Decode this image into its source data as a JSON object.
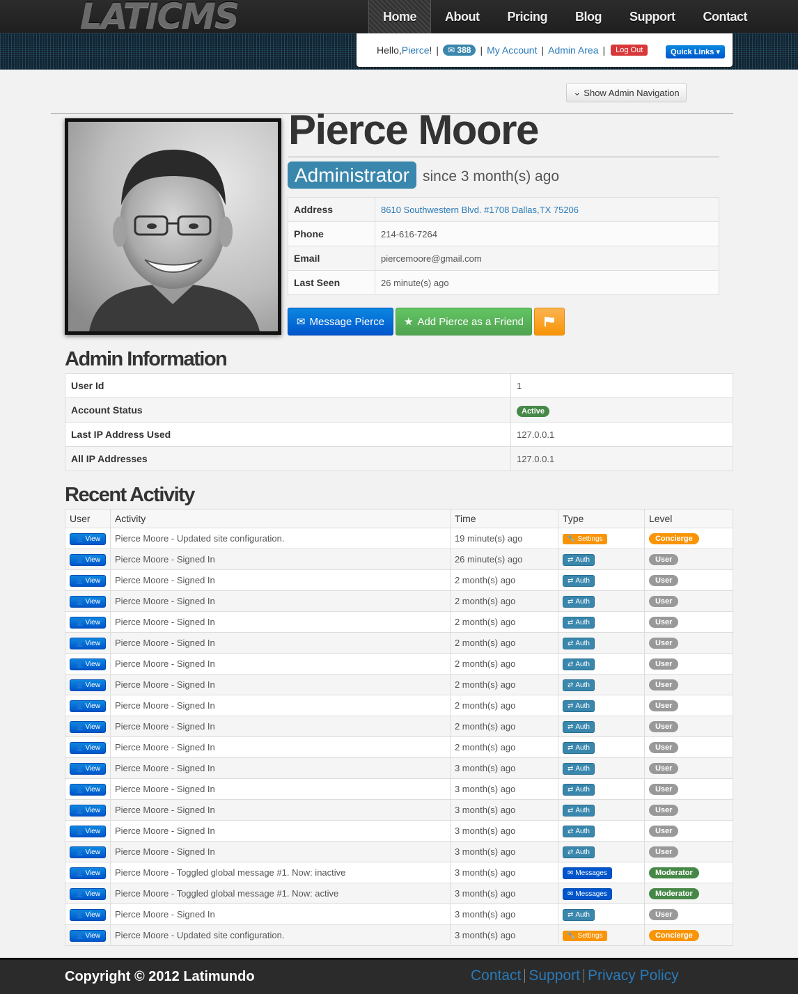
{
  "brand": {
    "logo": "LATICMS"
  },
  "nav": [
    {
      "label": "Home",
      "active": true
    },
    {
      "label": "About"
    },
    {
      "label": "Pricing"
    },
    {
      "label": "Blog"
    },
    {
      "label": "Support"
    },
    {
      "label": "Contact"
    }
  ],
  "userbar": {
    "hello": "Hello, ",
    "username": "Pierce",
    "exclaim": "!",
    "message_count": "388",
    "my_account": "My Account",
    "admin_area": "Admin Area",
    "logout": "Log Out",
    "quick_links": "Quick Links"
  },
  "admin_nav_button": "Show Admin Navigation",
  "profile": {
    "name": "Pierce Moore",
    "role": "Administrator",
    "since": "since 3 month(s) ago",
    "fields": [
      {
        "key": "Address",
        "value": "8610 Southwestern Blvd. #1708 Dallas,TX 75206",
        "link": true
      },
      {
        "key": "Phone",
        "value": "214-616-7264"
      },
      {
        "key": "Email",
        "value": "piercemoore@gmail.com"
      },
      {
        "key": "Last Seen",
        "value": "26 minute(s) ago"
      }
    ],
    "message_button": "Message Pierce",
    "friend_button": "Add Pierce as a Friend"
  },
  "admin_info": {
    "title": "Admin Information",
    "rows": [
      {
        "key": "User Id",
        "value": "1"
      },
      {
        "key": "Account Status",
        "value": "Active",
        "badge": true
      },
      {
        "key": "Last IP Address Used",
        "value": "127.0.0.1"
      },
      {
        "key": "All IP Addresses",
        "value": "127.0.0.1"
      }
    ]
  },
  "recent_activity": {
    "title": "Recent Activity",
    "columns": [
      "User",
      "Activity",
      "Time",
      "Type",
      "Level"
    ],
    "view_label": "View",
    "rows": [
      {
        "activity": "Pierce Moore - Updated site configuration.",
        "time": "19 minute(s) ago",
        "type": "Settings",
        "level": "Concierge"
      },
      {
        "activity": "Pierce Moore - Signed In",
        "time": "26 minute(s) ago",
        "type": "Auth",
        "level": "User"
      },
      {
        "activity": "Pierce Moore - Signed In",
        "time": "2 month(s) ago",
        "type": "Auth",
        "level": "User"
      },
      {
        "activity": "Pierce Moore - Signed In",
        "time": "2 month(s) ago",
        "type": "Auth",
        "level": "User"
      },
      {
        "activity": "Pierce Moore - Signed In",
        "time": "2 month(s) ago",
        "type": "Auth",
        "level": "User"
      },
      {
        "activity": "Pierce Moore - Signed In",
        "time": "2 month(s) ago",
        "type": "Auth",
        "level": "User"
      },
      {
        "activity": "Pierce Moore - Signed In",
        "time": "2 month(s) ago",
        "type": "Auth",
        "level": "User"
      },
      {
        "activity": "Pierce Moore - Signed In",
        "time": "2 month(s) ago",
        "type": "Auth",
        "level": "User"
      },
      {
        "activity": "Pierce Moore - Signed In",
        "time": "2 month(s) ago",
        "type": "Auth",
        "level": "User"
      },
      {
        "activity": "Pierce Moore - Signed In",
        "time": "2 month(s) ago",
        "type": "Auth",
        "level": "User"
      },
      {
        "activity": "Pierce Moore - Signed In",
        "time": "2 month(s) ago",
        "type": "Auth",
        "level": "User"
      },
      {
        "activity": "Pierce Moore - Signed In",
        "time": "3 month(s) ago",
        "type": "Auth",
        "level": "User"
      },
      {
        "activity": "Pierce Moore - Signed In",
        "time": "3 month(s) ago",
        "type": "Auth",
        "level": "User"
      },
      {
        "activity": "Pierce Moore - Signed In",
        "time": "3 month(s) ago",
        "type": "Auth",
        "level": "User"
      },
      {
        "activity": "Pierce Moore - Signed In",
        "time": "3 month(s) ago",
        "type": "Auth",
        "level": "User"
      },
      {
        "activity": "Pierce Moore - Signed In",
        "time": "3 month(s) ago",
        "type": "Auth",
        "level": "User"
      },
      {
        "activity": "Pierce Moore - Toggled global message #1. Now: inactive",
        "time": "3 month(s) ago",
        "type": "Messages",
        "level": "Moderator"
      },
      {
        "activity": "Pierce Moore - Toggled global message #1. Now: active",
        "time": "3 month(s) ago",
        "type": "Messages",
        "level": "Moderator"
      },
      {
        "activity": "Pierce Moore - Signed In",
        "time": "3 month(s) ago",
        "type": "Auth",
        "level": "User"
      },
      {
        "activity": "Pierce Moore - Updated site configuration.",
        "time": "3 month(s) ago",
        "type": "Settings",
        "level": "Concierge"
      }
    ]
  },
  "footer": {
    "copyright": "Copyright © 2012 Latimundo",
    "links": [
      "Contact",
      "Support",
      "Privacy Policy"
    ]
  },
  "colors": {
    "primary": "#0055cc",
    "info": "#3a87ad",
    "success": "#468847",
    "warning": "#f89406",
    "danger": "#d9383a"
  }
}
